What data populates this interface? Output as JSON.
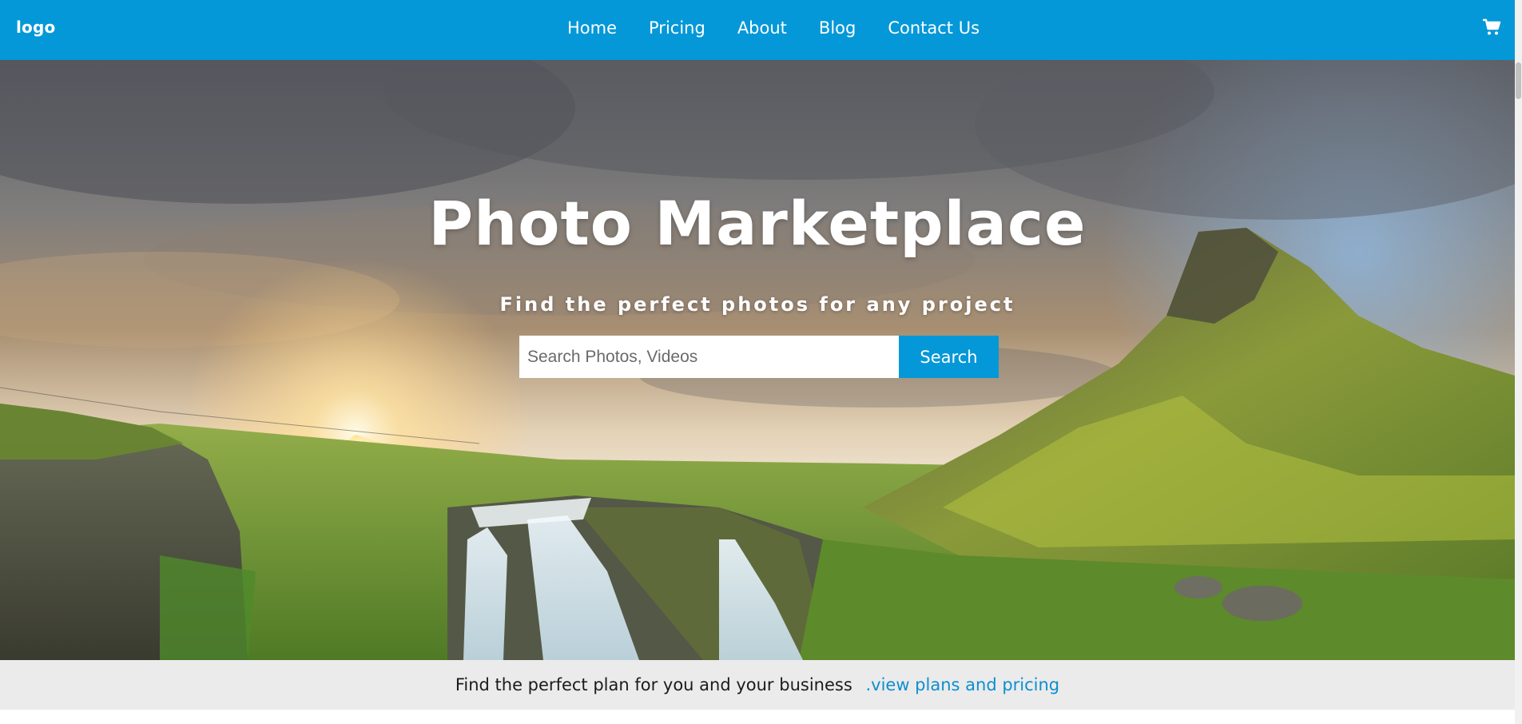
{
  "header": {
    "logo": "logo",
    "nav": [
      "Home",
      "Pricing",
      "About",
      "Blog",
      "Contact Us"
    ],
    "cart_icon": "shopping-cart-icon"
  },
  "hero": {
    "title": "Photo Marketplace",
    "subtitle": "Find the perfect photos for any project",
    "search": {
      "placeholder": "Search Photos, Videos",
      "value": "",
      "button_label": "Search"
    }
  },
  "banner": {
    "text": "Find the perfect plan for you and your business",
    "link_text": ".view plans and pricing"
  },
  "colors": {
    "brand": "#0498d8",
    "banner_bg": "#ebebeb",
    "link": "#0c8fcf"
  }
}
